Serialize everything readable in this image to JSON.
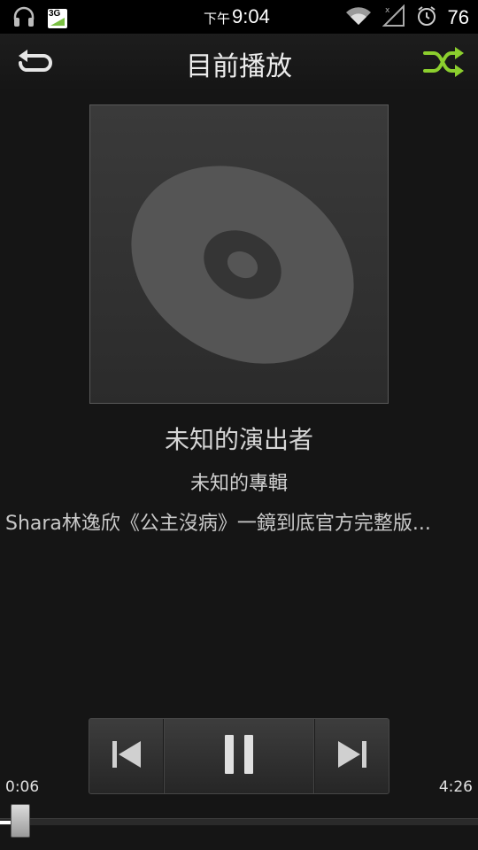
{
  "status_bar": {
    "clock_ampm": "下午",
    "clock_time": "9:04",
    "battery_percent": "76",
    "icons": [
      "headphones-icon",
      "3g-data-icon",
      "wifi-icon",
      "no-signal-icon",
      "alarm-icon"
    ],
    "network_label": "3G"
  },
  "header": {
    "title": "目前播放",
    "repeat_icon": "repeat-icon",
    "shuffle_icon": "shuffle-icon",
    "shuffle_color": "#8ccf2e"
  },
  "track": {
    "artist": "未知的演出者",
    "album": "未知的專輯",
    "title": "Shara林逸欣《公主沒病》一鏡到底官方完整版..."
  },
  "controls": {
    "prev_icon": "previous-icon",
    "pause_icon": "pause-icon",
    "next_icon": "next-icon"
  },
  "progress": {
    "elapsed": "0:06",
    "total": "4:26",
    "fraction": 0.023
  }
}
